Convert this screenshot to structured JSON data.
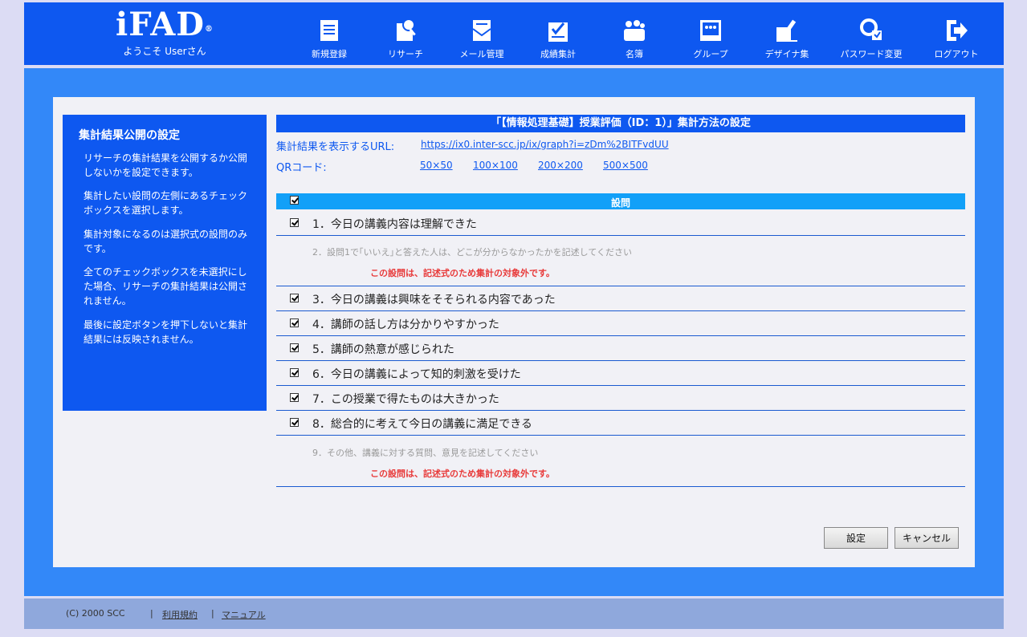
{
  "header": {
    "logo": "iFAD",
    "logo_mark": "®",
    "welcome": "ようこそ Userさん",
    "nav": [
      {
        "label": "新規登録",
        "icon": "new-registration-icon"
      },
      {
        "label": "リサーチ",
        "icon": "research-icon"
      },
      {
        "label": "メール管理",
        "icon": "mail-icon"
      },
      {
        "label": "成績集計",
        "icon": "grade-summary-icon"
      },
      {
        "label": "名簿",
        "icon": "roster-icon"
      },
      {
        "label": "グループ",
        "icon": "group-icon"
      },
      {
        "label": "デザイナ集",
        "icon": "design-icon"
      },
      {
        "label": "パスワード変更",
        "icon": "password-change-icon"
      },
      {
        "label": "ログアウト",
        "icon": "logout-icon"
      }
    ]
  },
  "sidebar": {
    "title": "集計結果公開の設定",
    "paragraphs": [
      "リサーチの集計結果を公開するか公開しないかを設定できます。",
      "集計したい設問の左側にあるチェックボックスを選択します。",
      "集計対象になるのは選択式の設問のみです。",
      "全てのチェックボックスを未選択にした場合、リサーチの集計結果は公開されません。",
      "最後に設定ボタンを押下しないと集計結果には反映されません。"
    ]
  },
  "main": {
    "title": "「【情報処理基礎】授業評価（ID：1）」集計方法の設定",
    "url_label": "集計結果を表示するURL:",
    "url": "https://ix0.inter-scc.jp/ix/graph?i=zDm%2BITFvdUU",
    "qr_label": "QRコード:",
    "qr_sizes": [
      "50×50",
      "100×100",
      "200×200",
      "500×500"
    ],
    "column_header": "設問",
    "questions": [
      {
        "text": "1．今日の講義内容は理解できた",
        "checked": true
      },
      {
        "text": "2．設問1で｢いいえ｣と答えた人は、どこが分からなかったかを記述してください",
        "note": "この設問は、記述式のため集計の対象外です。"
      },
      {
        "text": "3．今日の講義は興味をそそられる内容であった",
        "checked": true
      },
      {
        "text": "4．講師の話し方は分かりやすかった",
        "checked": true
      },
      {
        "text": "5．講師の熱意が感じられた",
        "checked": true
      },
      {
        "text": "6．今日の講義によって知的刺激を受けた",
        "checked": true
      },
      {
        "text": "7．この授業で得たものは大きかった",
        "checked": true
      },
      {
        "text": "8．総合的に考えて今日の講義に満足できる",
        "checked": true
      },
      {
        "text": "9．その他、講義に対する質問、意見を記述してください",
        "note": "この設問は、記述式のため集計の対象外です。"
      }
    ],
    "buttons": {
      "submit": "設定",
      "cancel": "キャンセル"
    }
  },
  "footer": {
    "copyright": "(C) 2000 SCC",
    "separator": "|",
    "links": [
      "利用規約",
      "マニュアル"
    ]
  },
  "colors": {
    "primary": "#0e58f0",
    "band": "#3388f8",
    "header_row": "#12a0f8",
    "note": "#e83a3a"
  }
}
